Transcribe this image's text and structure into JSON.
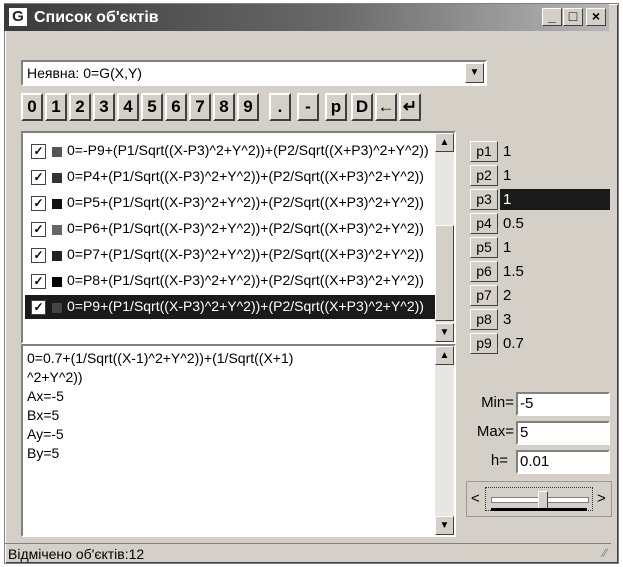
{
  "window": {
    "title": "Список об'єктів",
    "app_icon": "G",
    "colors": {
      "titlebar_start": "#3a3a3a",
      "selection": "#1a1a1a",
      "face": "#d4d0c8"
    }
  },
  "window_buttons": {
    "minimize": "_",
    "maximize": "□",
    "close": "×"
  },
  "combo": {
    "value": "Неявна: 0=G(X,Y)",
    "arrow_icon": "triangle-down-icon"
  },
  "keypad": [
    "0",
    "1",
    "2",
    "3",
    "4",
    "5",
    "6",
    "7",
    "8",
    "9",
    ".",
    "-",
    "p",
    "D",
    "←",
    "↵"
  ],
  "objects": [
    {
      "checked": true,
      "color": "#555555",
      "text": "0=-P9+(P1/Sqrt((X-P3)^2+Y^2))+(P2/Sqrt((X+P3)^2+Y^2))",
      "selected": false
    },
    {
      "checked": true,
      "color": "#333333",
      "text": "0=P4+(P1/Sqrt((X-P3)^2+Y^2))+(P2/Sqrt((X+P3)^2+Y^2))",
      "selected": false
    },
    {
      "checked": true,
      "color": "#111111",
      "text": "0=P5+(P1/Sqrt((X-P3)^2+Y^2))+(P2/Sqrt((X+P3)^2+Y^2))",
      "selected": false
    },
    {
      "checked": true,
      "color": "#666666",
      "text": "0=P6+(P1/Sqrt((X-P3)^2+Y^2))+(P2/Sqrt((X+P3)^2+Y^2))",
      "selected": false
    },
    {
      "checked": true,
      "color": "#222222",
      "text": "0=P7+(P1/Sqrt((X-P3)^2+Y^2))+(P2/Sqrt((X+P3)^2+Y^2))",
      "selected": false
    },
    {
      "checked": true,
      "color": "#000000",
      "text": "0=P8+(P1/Sqrt((X-P3)^2+Y^2))+(P2/Sqrt((X+P3)^2+Y^2))",
      "selected": false
    },
    {
      "checked": true,
      "color": "#444444",
      "text": "0=P9+(P1/Sqrt((X-P3)^2+Y^2))+(P2/Sqrt((X+P3)^2+Y^2))",
      "selected": true
    }
  ],
  "memo": {
    "lines": [
      "0=0.7+(1/Sqrt((X-1)^2+Y^2))+(1/Sqrt((X+1)",
      "^2+Y^2))",
      "Ax=-5",
      "Bx=5",
      "Ay=-5",
      "By=5"
    ]
  },
  "params": [
    {
      "name": "p1",
      "value": "1",
      "selected": false
    },
    {
      "name": "p2",
      "value": "1",
      "selected": false
    },
    {
      "name": "p3",
      "value": "1",
      "selected": true
    },
    {
      "name": "p4",
      "value": "0.5",
      "selected": false
    },
    {
      "name": "p5",
      "value": "1",
      "selected": false
    },
    {
      "name": "p6",
      "value": "1.5",
      "selected": false
    },
    {
      "name": "p7",
      "value": "2",
      "selected": false
    },
    {
      "name": "p8",
      "value": "3",
      "selected": false
    },
    {
      "name": "p9",
      "value": "0.7",
      "selected": false
    }
  ],
  "range": {
    "min_label": "Min=",
    "min_value": "-5",
    "max_label": "Max=",
    "max_value": "5",
    "h_label": "h=",
    "h_value": "0.01"
  },
  "slider": {
    "left_arrow": "<",
    "right_arrow": ">",
    "position": 0.55
  },
  "status": {
    "text": "Відмічено об'єктів:12"
  }
}
